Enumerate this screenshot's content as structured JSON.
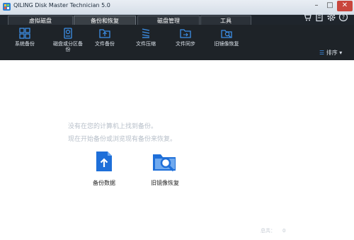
{
  "window": {
    "title": "QILING Disk Master Technician 5.0",
    "min": "–",
    "max": "□",
    "close": "✕"
  },
  "tabs": [
    {
      "label": "虚拟磁盘",
      "active": false
    },
    {
      "label": "备份和恢复",
      "active": true
    },
    {
      "label": "磁盘管理",
      "active": false
    },
    {
      "label": "工具",
      "active": false
    }
  ],
  "toolbar": {
    "items": [
      {
        "label": "系统备份",
        "icon": "system-backup-icon"
      },
      {
        "label": "磁盘或分区备份",
        "icon": "disk-partition-backup-icon"
      },
      {
        "label": "文件备份",
        "icon": "file-backup-icon"
      },
      {
        "label": "文件压缩",
        "icon": "file-compress-icon"
      },
      {
        "label": "文件同步",
        "icon": "file-sync-icon"
      },
      {
        "label": "旧镜像恢复",
        "icon": "old-image-restore-icon"
      }
    ],
    "sort_label": "排序"
  },
  "content": {
    "message_line1": "没有在您的计算机上找到备份。",
    "message_line2": "现在开始备份或浏览现有备份来恢复。",
    "actions": [
      {
        "label": "备份数据",
        "icon": "backup-data-icon"
      },
      {
        "label": "旧镜像恢复",
        "icon": "browse-restore-icon"
      }
    ],
    "total_label": "总共：",
    "total_value": "0"
  },
  "colors": {
    "accent": "#1e6fd9",
    "toolbar_bg": "#1e2328",
    "tab_bg": "#1f252c"
  }
}
